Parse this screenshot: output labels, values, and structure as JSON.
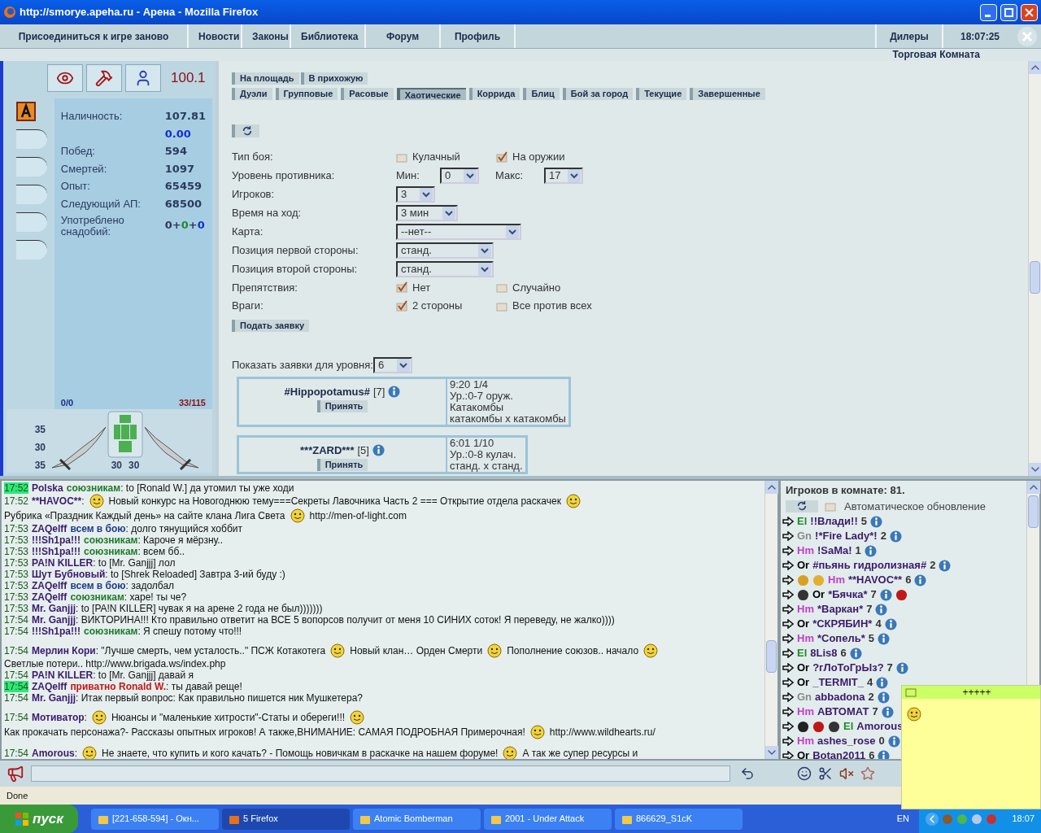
{
  "window": {
    "title": "http://smorye.apeha.ru - Арена - Mozilla Firefox"
  },
  "nav": {
    "items": [
      {
        "label": "Присоединиться к игре заново"
      },
      {
        "label": "Новости"
      },
      {
        "label": "Законы"
      },
      {
        "label": "Библиотека"
      },
      {
        "label": "Форум"
      },
      {
        "label": "Профиль"
      }
    ],
    "right_items": [
      {
        "label": "Дилеры"
      }
    ],
    "clock": "18:07:25",
    "room": "Торговая Комната"
  },
  "character": {
    "rating": "100.1",
    "stats": [
      {
        "label": "Наличность:",
        "value": "107.81",
        "accent": false
      },
      {
        "value": "0.00",
        "accent": true
      },
      {
        "label": "Побед:",
        "value": "594",
        "accent": false
      },
      {
        "label": "Смертей:",
        "value": "1097",
        "accent": false
      },
      {
        "label": "Опыт:",
        "value": "65459",
        "accent": false
      },
      {
        "label": "Следующий АП:",
        "value": "68500",
        "accent": false
      }
    ],
    "potions": {
      "label": "Употреблено снадобий:",
      "parts": [
        {
          "text": "0+",
          "color": "#2b3a5e"
        },
        {
          "text": "0",
          "color": "#1e8a2a"
        },
        {
          "text": "+",
          "color": "#2b3a5e"
        },
        {
          "text": "0",
          "color": "#1030d0"
        }
      ]
    },
    "mana": "0/0",
    "hp": "33/115",
    "side_values": [
      "35",
      "30",
      "35"
    ],
    "bottom_values": [
      "30",
      "30"
    ]
  },
  "arena": {
    "top_tabs": [
      {
        "label": "На площадь"
      },
      {
        "label": "В прихожую"
      }
    ],
    "tabs": [
      {
        "label": "Дуэли",
        "selected": false
      },
      {
        "label": "Групповые",
        "selected": false
      },
      {
        "label": "Расовые",
        "selected": false
      },
      {
        "label": "Хаотические",
        "selected": true
      },
      {
        "label": "Коррида",
        "selected": false
      },
      {
        "label": "Блиц",
        "selected": false
      },
      {
        "label": "Бой за город",
        "selected": false
      },
      {
        "label": "Текущие",
        "selected": false
      },
      {
        "label": "Завершенные",
        "selected": false
      }
    ],
    "form": [
      {
        "kind": "checks",
        "label": "Тип боя:",
        "options": [
          {
            "label": "Кулачный",
            "checked": false
          },
          {
            "label": "На оружии",
            "checked": true
          }
        ]
      },
      {
        "kind": "range",
        "label": "Уровень противника:",
        "min_label": "Мин:",
        "min": "0",
        "max_label": "Макс:",
        "max": "17"
      },
      {
        "kind": "select",
        "label": "Игроков:",
        "value": "3"
      },
      {
        "kind": "select",
        "label": "Время на ход:",
        "value": "3 мин"
      },
      {
        "kind": "select",
        "label": "Карта:",
        "value": "--нет--"
      },
      {
        "kind": "select",
        "label": "Позиция первой стороны:",
        "value": "станд."
      },
      {
        "kind": "select",
        "label": "Позиция второй стороны:",
        "value": "станд."
      },
      {
        "kind": "checks",
        "label": "Препятствия:",
        "options": [
          {
            "label": "Нет",
            "checked": true
          },
          {
            "label": "Случайно",
            "checked": false
          }
        ]
      },
      {
        "kind": "checks",
        "label": "Враги:",
        "options": [
          {
            "label": "2 стороны",
            "checked": true
          },
          {
            "label": "Все против всех",
            "checked": false
          }
        ]
      }
    ],
    "submit": "Подать заявку",
    "level_filter": {
      "label": "Показать заявки для уровня:",
      "value": "6"
    },
    "applications": [
      {
        "name": "#Hippopotamus#",
        "level": "[7]",
        "accept": "Принять",
        "details": [
          "9:20 1/4",
          "Ур.:0-7 оруж.",
          "Катакомбы",
          "катакомбы x катакомбы"
        ]
      },
      {
        "name": "***ZARD***",
        "level": "[5]",
        "accept": "Принять",
        "details": [
          "6:01 1/10",
          "Ур.:0-8 кулач.",
          "станд. x станд."
        ]
      }
    ]
  },
  "chat": {
    "messages": [
      {
        "time": "17:52",
        "time_highlight": true,
        "author": "Polska",
        "channel": {
          "kind": "allies",
          "label": "союзникам"
        },
        "segments": [
          ": to [Ronald W.] да утомил ты уже ходи"
        ]
      },
      {
        "time": "17:52",
        "time_highlight": false,
        "author": "**HAVOC**",
        "segments": [
          ":",
          "Новый конкурс на Новогоднюю тему===Секреты Лавочника Часть 2 === Открытие отдела раскачек",
          "Рубрика «Праздник Каждый день» на сайте клана Лига Света",
          "http://men-of-light.com"
        ]
      },
      {
        "time": "17:53",
        "time_highlight": false,
        "author": "ZAQelff",
        "channel": {
          "kind": "battle",
          "label": "всем в бою"
        },
        "segments": [
          ": долго тянущийся хоббит"
        ]
      },
      {
        "time": "17:53",
        "time_highlight": false,
        "author": "!!!Sh1pa!!!",
        "channel": {
          "kind": "allies",
          "label": "союзникам"
        },
        "segments": [
          ": Кароче я мёрзну.."
        ]
      },
      {
        "time": "17:53",
        "time_highlight": false,
        "author": "!!!Sh1pa!!!",
        "channel": {
          "kind": "allies",
          "label": "союзникам"
        },
        "segments": [
          ": всем бб.."
        ]
      },
      {
        "time": "17:53",
        "time_highlight": false,
        "author": "PA!N KILLER",
        "segments": [
          ": to [Mr. Ganjjj] лол"
        ]
      },
      {
        "time": "17:53",
        "time_highlight": false,
        "author": "Шут Бубновый",
        "segments": [
          ": to [Shrek Reloaded] Завтра 3-ий буду :)"
        ]
      },
      {
        "time": "17:53",
        "time_highlight": false,
        "author": "ZAQelff",
        "channel": {
          "kind": "battle",
          "label": "всем в бою"
        },
        "segments": [
          ": задолбал"
        ]
      },
      {
        "time": "17:53",
        "time_highlight": false,
        "author": "ZAQelff",
        "channel": {
          "kind": "allies",
          "label": "союзникам"
        },
        "segments": [
          ": харе! ты че?"
        ]
      },
      {
        "time": "17:53",
        "time_highlight": false,
        "author": "Mr. Ganjjj",
        "segments": [
          ": to [PA!N KILLER] чувак я на арене 2 года не был)))))))"
        ]
      },
      {
        "time": "17:54",
        "time_highlight": false,
        "author": "Mr. Ganjjj",
        "segments": [
          ": ВИКТОРИНА!!! Кто правильно ответит на ВСЕ 5 вопорсов получит от меня 10 СИНИХ соток! Я переведу, не жалко))))"
        ]
      },
      {
        "time": "17:54",
        "time_highlight": false,
        "author": "!!!Sh1pa!!!",
        "channel": {
          "kind": "allies",
          "label": "союзникам"
        },
        "segments": [
          ": Я спешу потому что!!!"
        ]
      },
      {
        "time": "17:54",
        "time_highlight": false,
        "author": "Мерлин Кори",
        "segments": [
          ": \"Лучше смерть, чем усталость..\" ПСЖ Котакотега",
          "Новый клан… Орден Смерти",
          "Пополнение союзов.. начало",
          "Светлые потери.. http://www.brigada.ws/index.php"
        ]
      },
      {
        "time": "17:54",
        "time_highlight": false,
        "author": "PA!N KILLER",
        "segments": [
          ": to [Mr. Ganjjj] давай я"
        ]
      },
      {
        "time": "17:54",
        "time_highlight": true,
        "author": "ZAQelff",
        "channel": {
          "kind": "private",
          "label": "приватно Ronald W."
        },
        "segments": [
          ": ты давай реще!"
        ]
      },
      {
        "time": "17:54",
        "time_highlight": false,
        "author": "Mr. Ganjjj",
        "segments": [
          ": Итак первый вопрос: Как правильно пишется ник Мушкетера?"
        ]
      },
      {
        "time": "17:54",
        "time_highlight": false,
        "author": "Мотиватор",
        "segments": [
          ":",
          "Нюансы и \"маленькие хитрости\"-Статы и обереги!!!",
          "Как прокачать персонажа?- Рассказы опытных игроков! А также,ВНИМАНИЕ: САМАЯ ПОДРОБНАЯ Примерочная!",
          "http://www.wildhearts.ru/"
        ]
      },
      {
        "time": "17:54",
        "time_highlight": false,
        "author": "Amorous",
        "segments": [
          ":",
          "Не знаете, что купить и кого качать? - Помощь новичкам в раскачке на нашем форуме!",
          "А так же супер ресурсы и"
        ]
      }
    ]
  },
  "players": {
    "title": "Игроков в комнате: 81.",
    "auto_update": {
      "label": "Автоматическое обновление",
      "checked": false
    },
    "list": [
      {
        "race": "El",
        "color": "#1e8a2a",
        "name": "!!Влади!!",
        "level": "5"
      },
      {
        "race": "Gn",
        "color": "#8a8a8a",
        "name": "!*Fire Lady*!",
        "level": "2"
      },
      {
        "race": "Hm",
        "color": "#c040c8",
        "name": "!SaMa!",
        "level": "1"
      },
      {
        "race": "Or",
        "color": "#000000",
        "name": "#пьянь гидролизная#",
        "level": "2"
      },
      {
        "badges": [
          {
            "color": "#d8a020"
          },
          {
            "color": "#e0b030"
          }
        ],
        "race": "Hm",
        "color": "#c040c8",
        "name": "**HAVOC**",
        "level": "6"
      },
      {
        "badges": [
          {
            "color": "#333333"
          }
        ],
        "race": "Or",
        "color": "#000000",
        "name": "*Бячка*",
        "level": "7",
        "after_badges": [
          {
            "color": "#c01818"
          }
        ]
      },
      {
        "race": "Hm",
        "color": "#c040c8",
        "name": "*Варкан*",
        "level": "7"
      },
      {
        "race": "Or",
        "color": "#000000",
        "name": "*СКРЯБИН*",
        "level": "4"
      },
      {
        "race": "Hm",
        "color": "#c040c8",
        "name": "*Сопель*",
        "level": "5"
      },
      {
        "race": "El",
        "color": "#1e8a2a",
        "name": "8Lis8",
        "level": "6"
      },
      {
        "race": "Or",
        "color": "#000000",
        "name": "?гЛоТоГрЫз?",
        "level": "7"
      },
      {
        "race": "Or",
        "color": "#000000",
        "name": "_TERMIT_",
        "level": "4"
      },
      {
        "race": "Gn",
        "color": "#8a8a8a",
        "name": "abbadona",
        "level": "2"
      },
      {
        "race": "Hm",
        "color": "#c040c8",
        "name": "АВТОМАТ",
        "level": "7"
      },
      {
        "badges": [
          {
            "color": "#222222"
          },
          {
            "color": "#c01818"
          },
          {
            "color": "#333333"
          }
        ],
        "race": "El",
        "color": "#1e8a2a",
        "name": "Amorous"
      },
      {
        "race": "Hm",
        "color": "#c040c8",
        "name": "ashes_rose",
        "level": "0"
      },
      {
        "race": "Or",
        "color": "#000000",
        "name": "Botan2011",
        "level": "6"
      }
    ]
  },
  "popup": {
    "title": "+++++"
  },
  "status_bar": "Done",
  "taskbar": {
    "start": "пуск",
    "items": [
      {
        "label": "[221-658-594] - Окн...",
        "selected": false
      },
      {
        "label": "5 Firefox",
        "selected": true
      },
      {
        "label": "Atomic Bomberman",
        "selected": false
      },
      {
        "label": "2001 - Under Attack",
        "selected": false
      },
      {
        "label": "866629_S1cK",
        "selected": false
      }
    ],
    "language": "EN",
    "clock": "18:07"
  }
}
